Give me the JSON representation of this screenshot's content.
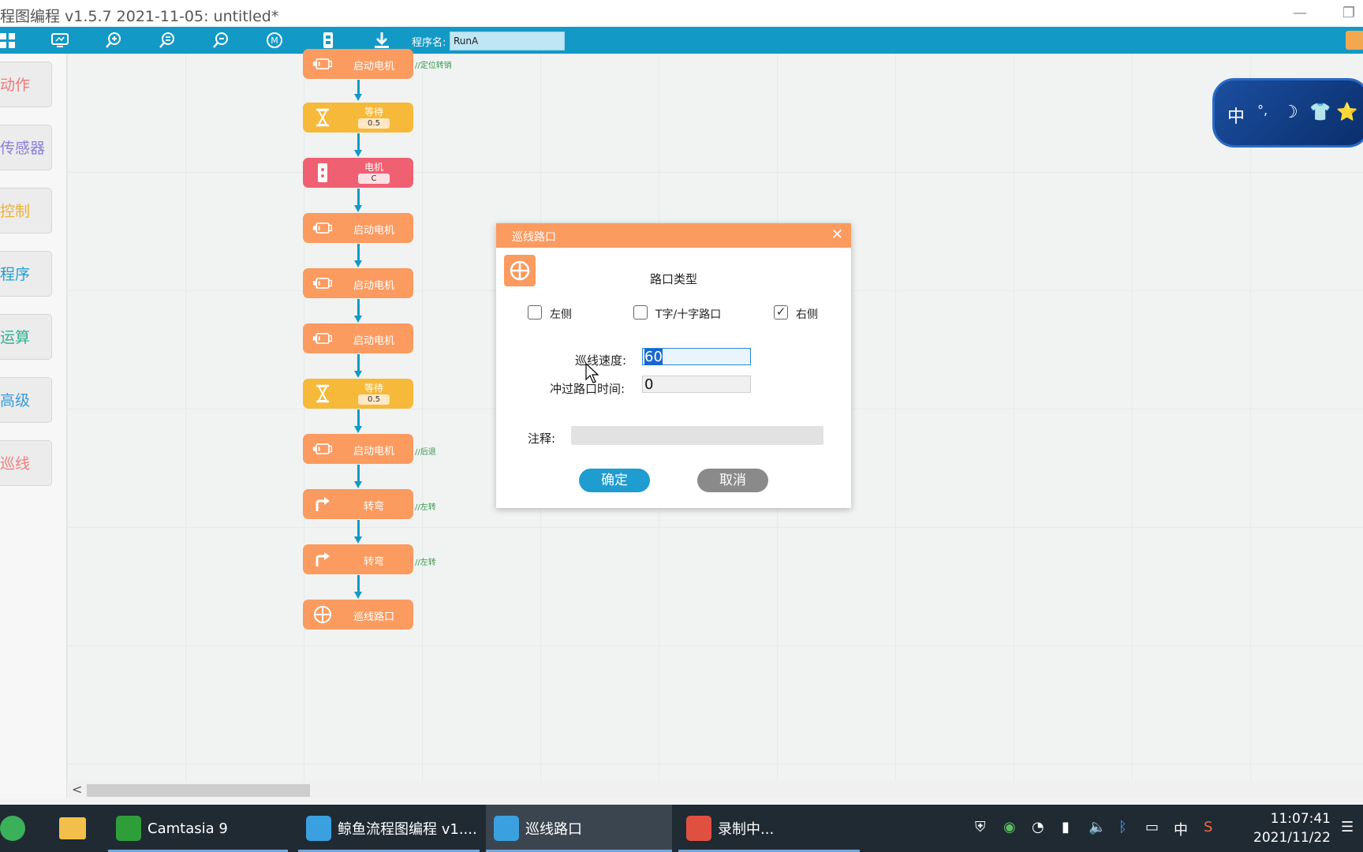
{
  "window": {
    "title": "程图编程 v1.5.7 2021-11-05:  untitled*"
  },
  "toolbar": {
    "icons": [
      "grid-icon",
      "monitor-icon",
      "zoom-in-icon",
      "zoom-fit-icon",
      "zoom-out-icon",
      "m-icon",
      "robot-icon",
      "download-icon"
    ],
    "program_name_label": "程序名:",
    "program_name_value": "RunA"
  },
  "sidebar": {
    "items": [
      {
        "label": "动作",
        "color": "#f07878"
      },
      {
        "label": "传感器",
        "color": "#8a7fd6"
      },
      {
        "label": "控制",
        "color": "#f0b030"
      },
      {
        "label": "程序",
        "color": "#20a0d0"
      },
      {
        "label": "运算",
        "color": "#30b090"
      },
      {
        "label": "高级",
        "color": "#3a9ad8"
      },
      {
        "label": "巡线",
        "color": "#f08080"
      }
    ]
  },
  "flow": {
    "blocks": [
      {
        "type": "motor",
        "label": "启动电机",
        "comment": "//定位转销"
      },
      {
        "type": "wait",
        "label": "等待",
        "value": "0.5"
      },
      {
        "type": "motor-stop",
        "label": "电机",
        "value": "C"
      },
      {
        "type": "motor",
        "label": "启动电机"
      },
      {
        "type": "motor",
        "label": "启动电机"
      },
      {
        "type": "motor",
        "label": "启动电机"
      },
      {
        "type": "wait",
        "label": "等待",
        "value": "0.5"
      },
      {
        "type": "motor",
        "label": "启动电机",
        "comment": "//后退"
      },
      {
        "type": "turn",
        "label": "转弯",
        "comment": "//左转"
      },
      {
        "type": "turn",
        "label": "转弯",
        "comment": "//左转"
      },
      {
        "type": "line",
        "label": "巡线路口"
      }
    ]
  },
  "floater": {
    "chars": [
      "中",
      "°,",
      "☽",
      "👕",
      "⭐"
    ]
  },
  "dialog": {
    "title": "巡线路口",
    "heading": "路口类型",
    "options": [
      {
        "label": "左侧",
        "checked": false
      },
      {
        "label": "T字/十字路口",
        "checked": false
      },
      {
        "label": "右侧",
        "checked": true
      }
    ],
    "speed_label": "巡线速度:",
    "speed_value": "60",
    "pass_time_label": "冲过路口时间:",
    "pass_time_value": "0",
    "note_label": "注释:",
    "note_value": "",
    "ok_label": "确定",
    "cancel_label": "取消"
  },
  "taskbar": {
    "apps": [
      {
        "label": "Camtasia 9",
        "color": "#2e9e3a"
      },
      {
        "label": "鲸鱼流程图编程 v1....",
        "color": "#3aa0e0"
      },
      {
        "label": "巡线路口",
        "color": "#3aa0e0"
      },
      {
        "label": "录制中...",
        "color": "#e05040"
      }
    ],
    "tray_ime": "中",
    "time": "11:07:41",
    "date": "2021/11/22"
  }
}
